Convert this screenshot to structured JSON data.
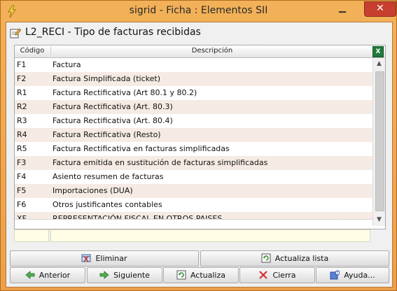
{
  "window": {
    "title": "sigrid - Ficha : Elementos SII"
  },
  "form": {
    "title": "L2_RECI - Tipo de facturas recibidas"
  },
  "grid": {
    "columns": {
      "code": "Código",
      "description": "Descripción"
    },
    "rows": [
      {
        "code": "F1",
        "description": "Factura"
      },
      {
        "code": "F2",
        "description": "Factura Simplificada (ticket)"
      },
      {
        "code": "R1",
        "description": "Factura Rectificativa (Art 80.1 y 80.2)"
      },
      {
        "code": "R2",
        "description": "Factura Rectificativa (Art. 80.3)"
      },
      {
        "code": "R3",
        "description": "Factura Rectificativa (Art. 80.4)"
      },
      {
        "code": "R4",
        "description": "Factura Rectificativa (Resto)"
      },
      {
        "code": "R5",
        "description": "Factura Rectificativa en facturas simplificadas"
      },
      {
        "code": "F3",
        "description": "Factura emitida en sustitución de facturas simplificadas"
      },
      {
        "code": "F4",
        "description": "Asiento resumen de facturas"
      },
      {
        "code": "F5",
        "description": "Importaciones (DUA)"
      },
      {
        "code": "F6",
        "description": "Otros justificantes contables"
      },
      {
        "code": "XF",
        "description": "REPRESENTACIÓN FISCAL EN OTROS PAISES"
      }
    ]
  },
  "buttons": {
    "delete": "Eliminar",
    "refresh_list": "Actualiza lista",
    "previous": "Anterior",
    "next": "Siguiente",
    "update": "Actualiza",
    "close": "Cierra",
    "help": "Ayuda..."
  },
  "icons": {
    "app": "lightning-bolt-icon",
    "header": "edit-document-icon",
    "excel": "excel-export-icon",
    "delete": "delete-record-icon",
    "refresh": "refresh-icon",
    "previous": "arrow-left-icon",
    "next": "arrow-right-icon",
    "close": "close-x-icon",
    "help": "help-icon"
  },
  "colors": {
    "accent": "#eca04a",
    "close_button": "#c7402f",
    "row_alt": "#f6ebe4"
  }
}
